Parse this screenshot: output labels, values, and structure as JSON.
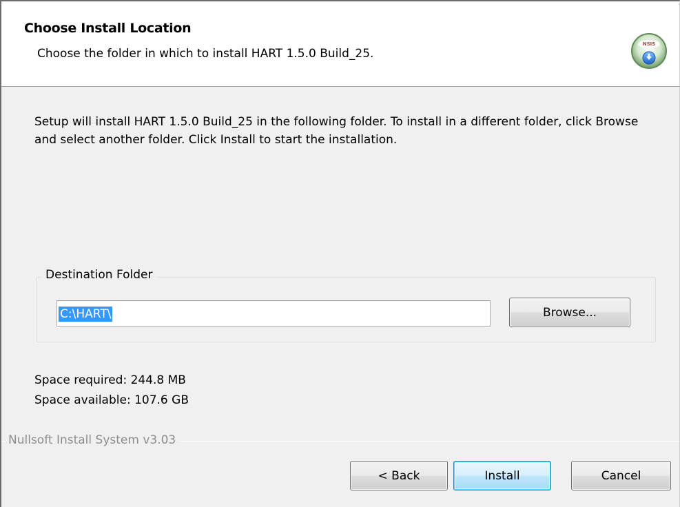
{
  "header": {
    "title": "Choose Install Location",
    "subtitle": "Choose the folder in which to install HART 1.5.0 Build_25.",
    "logo_icon": "nsis-installer-icon"
  },
  "body": {
    "description": "Setup will install HART 1.5.0 Build_25 in the following folder. To install in a different folder, click Browse and select another folder. Click Install to start the installation."
  },
  "destination": {
    "group_label": "Destination Folder",
    "path_value": "C:\\HART\\",
    "browse_label": "Browse..."
  },
  "space": {
    "required": "Space required: 244.8 MB",
    "available": "Space available: 107.6 GB"
  },
  "branding": {
    "text": "Nullsoft Install System v3.03"
  },
  "buttons": {
    "back_label": "< Back",
    "install_label": "Install",
    "cancel_label": "Cancel"
  },
  "colors": {
    "selection": "#3399ff",
    "window_bg": "#f0f0f0",
    "header_bg": "#ffffff",
    "default_button_border": "#3c7fb1"
  }
}
